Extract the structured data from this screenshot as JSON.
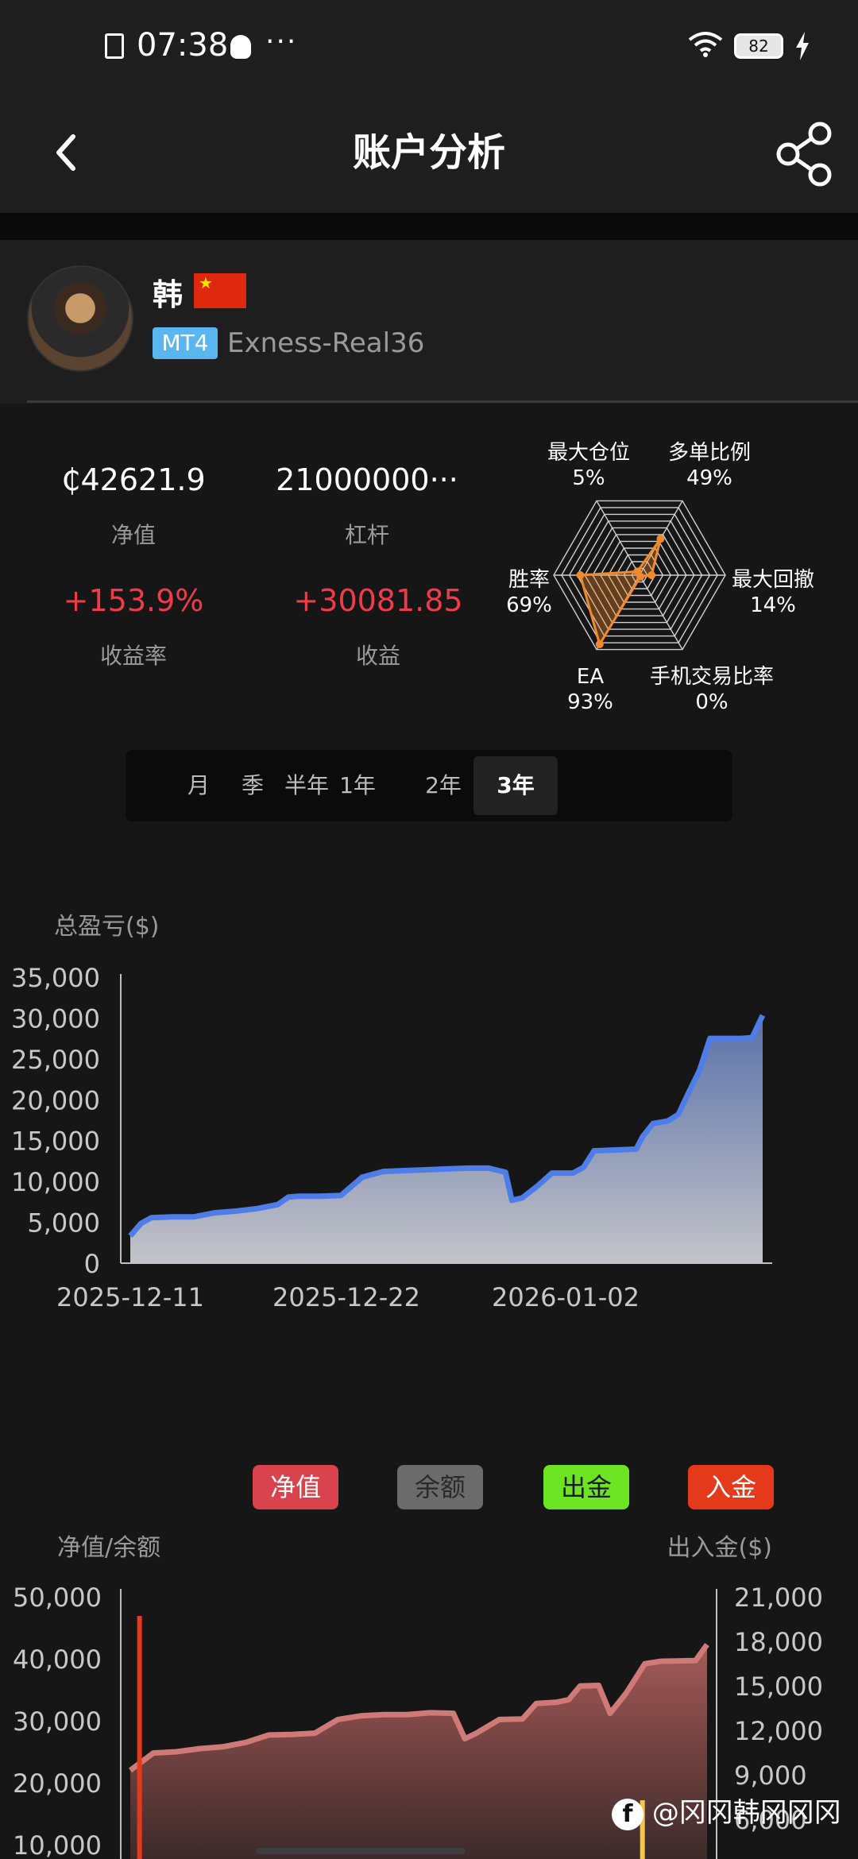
{
  "status_bar": {
    "time": "07:38",
    "dots": "···",
    "battery": "82"
  },
  "header": {
    "title": "账户分析"
  },
  "profile": {
    "name": "韩",
    "platform": "MT4",
    "account": "Exness-Real36"
  },
  "stats": {
    "equity": {
      "value": "₵42621.9",
      "label": "净值"
    },
    "leverage": {
      "value": "21000000···",
      "label": "杠杆"
    },
    "return_rate": {
      "value": "+153.9%",
      "label": "收益率"
    },
    "profit": {
      "value": "+30081.85",
      "label": "收益"
    }
  },
  "radar": {
    "axes": [
      {
        "name": "多单比例",
        "value": "49%",
        "score": 0.49
      },
      {
        "name": "最大回撤",
        "value": "14%",
        "score": 0.14
      },
      {
        "name": "手机交易比率",
        "value": "0%",
        "score": 0.0
      },
      {
        "name": "EA",
        "value": "93%",
        "score": 0.93
      },
      {
        "name": "胜率",
        "value": "69%",
        "score": 0.69
      },
      {
        "name": "最大仓位",
        "value": "5%",
        "score": 0.05
      }
    ],
    "line_color": "#f08a2c"
  },
  "period_tabs": [
    {
      "label": "月",
      "active": false
    },
    {
      "label": "季",
      "active": false
    },
    {
      "label": "半年",
      "active": false
    },
    {
      "label": "1年",
      "active": false
    },
    {
      "label": "2年",
      "active": false
    },
    {
      "label": "3年",
      "active": true
    }
  ],
  "legend": [
    {
      "label": "净值",
      "color": "#d9434e"
    },
    {
      "label": "余额",
      "color": "#6b6b6b"
    },
    {
      "label": "出金",
      "color": "#6ee522"
    },
    {
      "label": "入金",
      "color": "#e5391b"
    }
  ],
  "chart_data": [
    {
      "type": "area",
      "title": "总盈亏($)",
      "x_ticks": [
        "2025-12-11",
        "2025-12-22",
        "2026-01-02"
      ],
      "y_ticks": [
        "35,000",
        "30,000",
        "25,000",
        "20,000",
        "15,000",
        "10,000",
        "5,000",
        "0"
      ],
      "ylim": [
        0,
        35000
      ],
      "series": [
        {
          "color": "#4f7de8",
          "points": [
            [
              0,
              3300
            ],
            [
              0.5,
              4800
            ],
            [
              1,
              5500
            ],
            [
              2,
              5600
            ],
            [
              3,
              5600
            ],
            [
              4,
              6100
            ],
            [
              5,
              6300
            ],
            [
              6,
              6600
            ],
            [
              7,
              7100
            ],
            [
              7.5,
              8000
            ],
            [
              8,
              8100
            ],
            [
              9,
              8100
            ],
            [
              10,
              8200
            ],
            [
              11,
              10400
            ],
            [
              12,
              11100
            ],
            [
              13,
              11200
            ],
            [
              14,
              11300
            ],
            [
              15,
              11400
            ],
            [
              16,
              11500
            ],
            [
              17,
              11500
            ],
            [
              17.8,
              11000
            ],
            [
              18.1,
              7600
            ],
            [
              18.6,
              7900
            ],
            [
              19.3,
              9300
            ],
            [
              20,
              10900
            ],
            [
              21,
              10900
            ],
            [
              21.5,
              11600
            ],
            [
              22,
              13600
            ],
            [
              23,
              13700
            ],
            [
              24,
              13800
            ],
            [
              24.3,
              15300
            ],
            [
              24.8,
              16900
            ],
            [
              25.5,
              17200
            ],
            [
              26,
              18000
            ],
            [
              26.5,
              20700
            ],
            [
              27,
              23300
            ],
            [
              27.5,
              27200
            ],
            [
              28,
              27200
            ],
            [
              29,
              27200
            ],
            [
              29.5,
              27300
            ],
            [
              30,
              30000
            ]
          ]
        }
      ]
    },
    {
      "type": "area",
      "title": "净值/余额",
      "right_axis_title": "出入金($)",
      "y_ticks_left": [
        "50,000",
        "40,000",
        "30,000",
        "20,000",
        "10,000"
      ],
      "y_ticks_right": [
        "21,000",
        "18,000",
        "15,000",
        "12,000",
        "9,000",
        "6,000"
      ],
      "ylim_left": [
        10000,
        50000
      ],
      "ylim_right": [
        6000,
        21000
      ],
      "series": [
        {
          "name": "净值",
          "color": "#d07a78",
          "points": [
            [
              0,
              22000
            ],
            [
              1,
              24800
            ],
            [
              2,
              25000
            ],
            [
              3,
              25500
            ],
            [
              4,
              25800
            ],
            [
              5,
              26500
            ],
            [
              6,
              27700
            ],
            [
              7,
              27800
            ],
            [
              8,
              28000
            ],
            [
              9,
              30200
            ],
            [
              10,
              30800
            ],
            [
              11,
              31000
            ],
            [
              12,
              31000
            ],
            [
              13,
              31300
            ],
            [
              14,
              31200
            ],
            [
              14.5,
              27100
            ],
            [
              15,
              28000
            ],
            [
              16,
              30200
            ],
            [
              17,
              30300
            ],
            [
              17.6,
              32800
            ],
            [
              18.5,
              33000
            ],
            [
              19,
              33400
            ],
            [
              19.5,
              35600
            ],
            [
              20.3,
              35700
            ],
            [
              20.8,
              31200
            ],
            [
              21.5,
              34500
            ],
            [
              22.3,
              39200
            ],
            [
              23,
              39600
            ],
            [
              24.5,
              39700
            ],
            [
              25,
              42300
            ]
          ]
        }
      ],
      "markers": [
        {
          "label": "入金",
          "x": 0.4,
          "color": "#e5391b"
        },
        {
          "label": "出金",
          "x": 22.2,
          "color": "#f2c54b"
        }
      ]
    }
  ],
  "watermark": {
    "text": "@冈冈韩冈冈冈",
    "icon": "f"
  }
}
